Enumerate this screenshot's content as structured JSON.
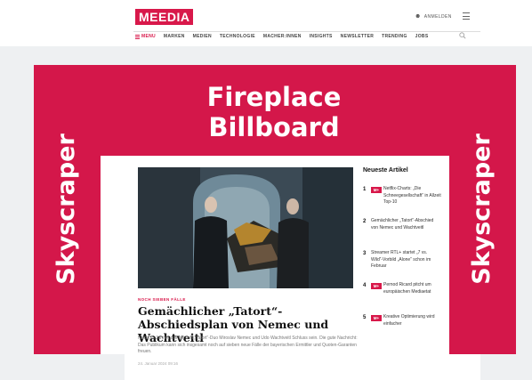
{
  "header": {
    "logo": "MEEDIA",
    "login_label": "ANMELDEN"
  },
  "nav": {
    "menu_label": "MENU",
    "items": [
      "MARKEN",
      "MEDIEN",
      "TECHNOLOGIE",
      "MACHER:INNEN",
      "INSIGHTS",
      "NEWSLETTER",
      "TRENDING",
      "JOBS"
    ]
  },
  "ads": {
    "billboard_label": "Fireplace\nBillboard",
    "skyscraper_left": "Skyscraper",
    "skyscraper_right": "Skyscraper"
  },
  "article": {
    "kicker": "NOCH SIEBEN FÄLLE",
    "headline": "Gemächlicher „Tatort“-Abschiedsplan von Nemec und Wachtveitl",
    "teaser": "Nach 35 Jahren soll bei den „Tatort“-Duo Miroslav Nemec und Udo Wachtveitl Schluss sein. Die gute Nachricht: Das Publikum kann sich insgesamt noch auf sieben neue Fälle der bayerischen Ermittler und Quoten-Garanten freuen.",
    "date": "24. Januar 2024 09:16"
  },
  "sidebar": {
    "title": "Neueste Artikel",
    "badge": "M+",
    "items": [
      {
        "num": "1",
        "text": "Netflix-Charts: „Die\nSchneegesellschaft“ in Allzeit\nTop-10",
        "premium": true
      },
      {
        "num": "2",
        "text": "Gemächlicher „Tatort“-Abschied\nvon Nemec und Wachtveitl",
        "premium": false
      },
      {
        "num": "3",
        "text": "Streamer RTL+ startet „7 vs.\nWild“-Vorbild „Alone“ schon im\nFebruar",
        "premium": false
      },
      {
        "num": "4",
        "text": "Pernod Ricard pitcht um\neuropäischen Mediaetat",
        "premium": true
      },
      {
        "num": "5",
        "text": "Kreative Optimierung wird\neinfacher",
        "premium": true
      }
    ]
  },
  "colors": {
    "brand": "#d8184a",
    "ad_frame": "#d4174a"
  }
}
